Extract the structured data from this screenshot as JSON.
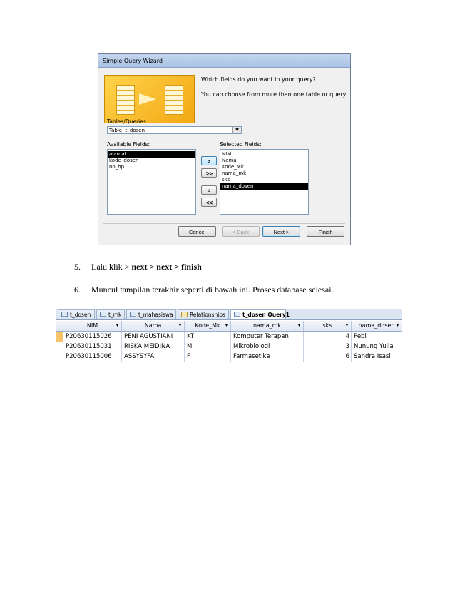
{
  "wizard": {
    "title": "Simple Query Wizard",
    "question": "Which fields do you want in your query?",
    "hint": "You can choose from more than one table or query.",
    "tables_label": "Tables/Queries",
    "table_selected": "Table: t_dosen",
    "available_label": "Available Fields:",
    "selected_label": "Selected Fields:",
    "available_fields": [
      "alamat",
      "kode_dosen",
      "no_hp"
    ],
    "selected_fields": [
      "NIM",
      "Nama",
      "Kode_Mk",
      "nama_mk",
      "sks",
      "nama_dosen"
    ],
    "move_one": ">",
    "move_all": ">>",
    "remove_one": "<",
    "remove_all": "<<",
    "cancel": "Cancel",
    "back": "< Back",
    "next": "Next >",
    "finish": "Finish"
  },
  "steps": [
    {
      "num": "5.",
      "text": "Lalu klik > ",
      "bold": "next > next > finish"
    },
    {
      "num": "6.",
      "text": "Muncul tampilan terakhir seperti di bawah ini. Proses database selesai.",
      "bold": ""
    }
  ],
  "sheet": {
    "tabs": [
      "t_dosen",
      "t_mk",
      "t_mahasiswa",
      "Relationships",
      "t_dosen Query1"
    ],
    "columns": [
      "NIM",
      "Nama",
      "Kode_Mk",
      "nama_mk",
      "sks",
      "nama_dosen"
    ],
    "rows": [
      [
        "P20630115026",
        "PENI AGUSTIANI",
        "KT",
        "Komputer Terapan",
        "4",
        "Pebi"
      ],
      [
        "P20630115031",
        "RISKA MEIDINA",
        "M",
        "Mikrobiologi",
        "3",
        "Nunung Yulia"
      ],
      [
        "P20630115006",
        "ASSYSYFA",
        "F",
        "Farmasetika",
        "6",
        "Sandra Isasi"
      ]
    ]
  }
}
